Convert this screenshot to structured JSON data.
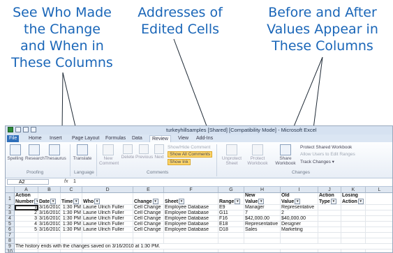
{
  "callouts": {
    "left": "See Who Made\nthe Change\nand When in\nThese Columns",
    "middle": "Addresses of\nEdited Cells",
    "right": "Before and After\nValues Appear in\nThese Columns"
  },
  "window": {
    "title": "turkeyhillsamples [Shared] [Compatibility Mode] - Microsoft Excel"
  },
  "ribbon": {
    "tabs": [
      "File",
      "Home",
      "Insert",
      "Page Layout",
      "Formulas",
      "Data",
      "Review",
      "View",
      "Add-Ins"
    ],
    "active_tab": "Review",
    "proofing": {
      "spelling": "Spelling",
      "research": "Research",
      "thesaurus": "Thesaurus",
      "label": "Proofing"
    },
    "language": {
      "translate": "Translate",
      "label": "Language"
    },
    "comments": {
      "new": "New Comment",
      "delete": "Delete",
      "previous": "Previous",
      "next": "Next",
      "show_hide": "Show/Hide Comment",
      "show_all": "Show All Comments",
      "show_ink": "Show Ink",
      "label": "Comments"
    },
    "changes": {
      "unprotect_sheet": "Unprotect Sheet",
      "protect_workbook": "Protect Workbook",
      "share_workbook": "Share Workbook",
      "protect_shared": "Protect Shared Workbook",
      "allow_users": "Allow Users to Edit Ranges",
      "track_changes": "Track Changes",
      "label": "Changes"
    }
  },
  "formula_bar": {
    "name_box": "A2",
    "fx": "fx",
    "value": "1"
  },
  "sheet": {
    "columns": [
      "A",
      "B",
      "C",
      "D",
      "E",
      "F",
      "G",
      "H",
      "I",
      "J",
      "K",
      "L"
    ],
    "header_top": [
      "Action",
      "",
      "",
      "",
      "",
      "",
      "",
      "New",
      "Old",
      "Action",
      "Losing"
    ],
    "header_bottom": [
      "Number",
      "Date",
      "Time",
      "Who",
      "Change",
      "Sheet",
      "Range",
      "Value",
      "Value",
      "Type",
      "Action"
    ],
    "rows": [
      [
        "1",
        "3/16/2010",
        "1:30 PM",
        "Laurie Ulrich Fuller",
        "Cell Change",
        "Employee Database",
        "E9",
        "Manager",
        "Representative",
        "",
        ""
      ],
      [
        "2",
        "3/16/2010",
        "1:30 PM",
        "Laurie Ulrich Fuller",
        "Cell Change",
        "Employee Database",
        "G11",
        "7",
        "2",
        "",
        ""
      ],
      [
        "3",
        "3/16/2010",
        "1:30 PM",
        "Laurie Ulrich Fuller",
        "Cell Change",
        "Employee Database",
        "F16",
        "$42,000.00",
        "$40,000.00",
        "",
        ""
      ],
      [
        "4",
        "3/16/2010",
        "1:30 PM",
        "Laurie Ulrich Fuller",
        "Cell Change",
        "Employee Database",
        "E18",
        "Representative",
        "Designer",
        "",
        ""
      ],
      [
        "5",
        "3/16/2010",
        "1:30 PM",
        "Laurie Ulrich Fuller",
        "Cell Change",
        "Employee Database",
        "D18",
        "Sales",
        "Marketing",
        "",
        ""
      ]
    ],
    "row_numbers": [
      "1",
      "2",
      "3",
      "4",
      "5",
      "6",
      "7",
      "8",
      "9",
      "10"
    ],
    "footer_note": "The history ends with the changes saved on 3/16/2010 at 1:30 PM."
  }
}
